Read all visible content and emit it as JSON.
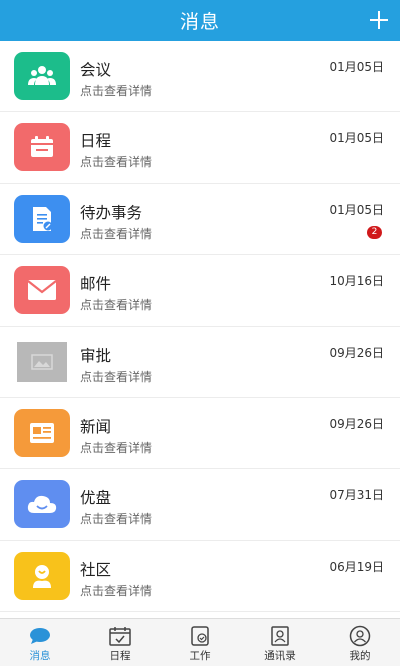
{
  "header": {
    "title": "消息"
  },
  "colors": {
    "header": "#25a0df",
    "badge": "#d0191b",
    "active_tab": "#2a92d8"
  },
  "messages": [
    {
      "title": "会议",
      "subtitle": "点击查看详情",
      "date": "01月05日",
      "icon": "people-group-icon",
      "color": "#1cbd8b"
    },
    {
      "title": "日程",
      "subtitle": "点击查看详情",
      "date": "01月05日",
      "icon": "calendar-icon",
      "color": "#f26a6b"
    },
    {
      "title": "待办事务",
      "subtitle": "点击查看详情",
      "date": "01月05日",
      "icon": "todo-document-icon",
      "color": "#3d8ff0",
      "badge": "2"
    },
    {
      "title": "邮件",
      "subtitle": "点击查看详情",
      "date": "10月16日",
      "icon": "envelope-icon",
      "color": "#f26a6b"
    },
    {
      "title": "审批",
      "subtitle": "点击查看详情",
      "date": "09月26日",
      "icon": "image-placeholder-icon",
      "color": "#b8b8b8"
    },
    {
      "title": "新闻",
      "subtitle": "点击查看详情",
      "date": "09月26日",
      "icon": "newspaper-icon",
      "color": "#f59a3a"
    },
    {
      "title": "优盘",
      "subtitle": "点击查看详情",
      "date": "07月31日",
      "icon": "cloud-icon",
      "color": "#5f8ef0"
    },
    {
      "title": "社区",
      "subtitle": "点击查看详情",
      "date": "06月19日",
      "icon": "community-person-icon",
      "color": "#f8c21b"
    }
  ],
  "tabs": [
    {
      "label": "消息",
      "icon": "chat-bubble-icon",
      "active": true
    },
    {
      "label": "日程",
      "icon": "calendar-check-icon"
    },
    {
      "label": "工作",
      "icon": "work-checklist-icon"
    },
    {
      "label": "通讯录",
      "icon": "contacts-book-icon"
    },
    {
      "label": "我的",
      "icon": "user-profile-icon"
    }
  ]
}
